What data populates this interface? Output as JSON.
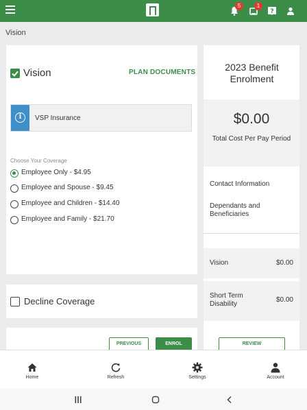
{
  "topbar": {
    "badges": {
      "notifications": "5",
      "messages": "1"
    }
  },
  "breadcrumb": "Vision",
  "vision_card": {
    "title": "Vision",
    "plan_documents": "PLAN DOCUMENTS",
    "insurance": "VSP Insurance",
    "choose_label": "Choose Your Coverage",
    "options": [
      {
        "label": "Employee Only - $4.95",
        "selected": true
      },
      {
        "label": "Employee and Spouse - $9.45",
        "selected": false
      },
      {
        "label": "Employee and Children - $14.40",
        "selected": false
      },
      {
        "label": "Employee and Family - $21.70",
        "selected": false
      }
    ]
  },
  "decline_card": {
    "label": "Decline Coverage"
  },
  "buttons": {
    "previous": "PREVIOUS",
    "enrol": "ENROL",
    "review": "REVIEW"
  },
  "summary": {
    "title": "2023 Benefit Enrolment",
    "total_cost": "$0.00",
    "total_caption": "Total Cost Per Pay Period",
    "links": [
      "Contact Information",
      "Dependants and Beneficiaries"
    ],
    "rows": [
      {
        "name": "Vision",
        "amount": "$0.00"
      },
      {
        "name": "Short Term Disability",
        "amount": "$0.00"
      }
    ]
  },
  "bottom_nav": [
    {
      "label": "Home",
      "icon": "home-icon"
    },
    {
      "label": "Refresh",
      "icon": "refresh-icon"
    },
    {
      "label": "Settings",
      "icon": "gear-icon"
    },
    {
      "label": "Account",
      "icon": "account-icon"
    }
  ],
  "colors": {
    "brand": "#3b8d48",
    "info": "#3f90c8",
    "badge": "#e53935"
  }
}
